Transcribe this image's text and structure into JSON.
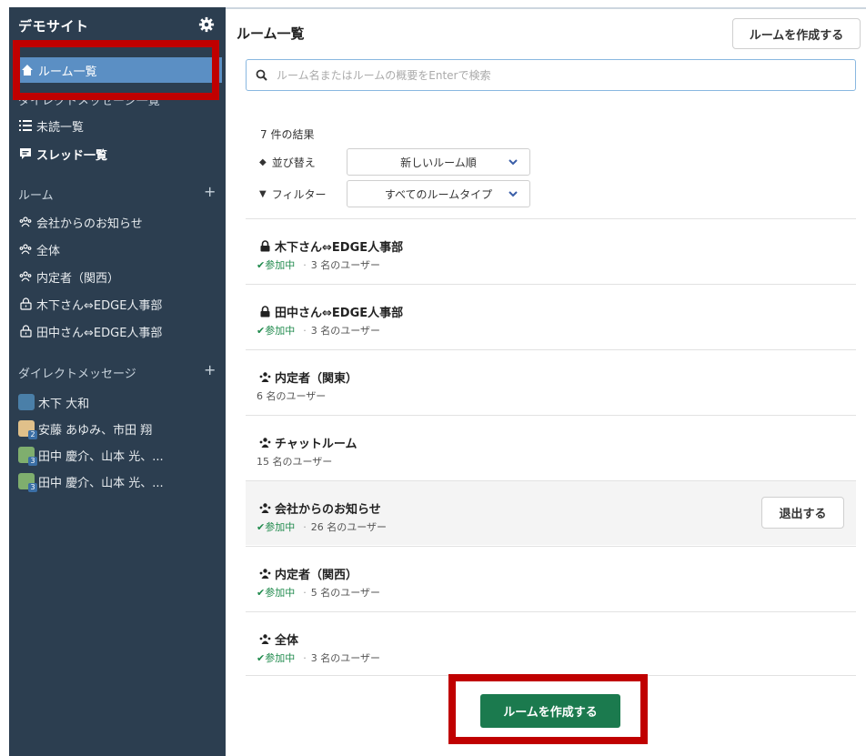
{
  "sidebar": {
    "title": "デモサイト",
    "nav": {
      "rooms_list": "ルーム一覧",
      "direct_list_hidden": "ダイレクトメッセージ一覧",
      "unread": "未読一覧",
      "threads": "スレッド一覧"
    },
    "rooms_section": "ルーム",
    "rooms": [
      {
        "label": "会社からのお知らせ",
        "icon": "group-icon"
      },
      {
        "label": "全体",
        "icon": "group-icon"
      },
      {
        "label": "内定者（関西）",
        "icon": "group-icon"
      },
      {
        "label": "木下さん⇔EDGE人事部",
        "icon": "lock-icon"
      },
      {
        "label": "田中さん⇔EDGE人事部",
        "icon": "lock-icon"
      }
    ],
    "dm_section": "ダイレクトメッセージ",
    "dms": [
      {
        "label": "木下 大和",
        "count": ""
      },
      {
        "label": "安藤 あゆみ、市田 翔",
        "count": "2"
      },
      {
        "label": "田中 慶介、山本 光、...",
        "count": "3"
      },
      {
        "label": "田中 慶介、山本 光、...",
        "count": "3"
      }
    ]
  },
  "main": {
    "title": "ルーム一覧",
    "create_button": "ルームを作成する",
    "search_placeholder": "ルーム名またはルームの概要をEnterで検索",
    "results": "7 件の結果",
    "sort_label": "並び替え",
    "sort_value": "新しいルーム順",
    "filter_label": "フィルター",
    "filter_value": "すべてのルームタイプ",
    "rooms": [
      {
        "name": "木下さん⇔EDGE人事部",
        "icon": "lock-icon",
        "joined": "✔参加中",
        "users": "3 名のユーザー"
      },
      {
        "name": "田中さん⇔EDGE人事部",
        "icon": "lock-icon",
        "joined": "✔参加中",
        "users": "3 名のユーザー"
      },
      {
        "name": "内定者（関東）",
        "icon": "group-icon",
        "joined": "",
        "users": "6 名のユーザー"
      },
      {
        "name": "チャットルーム",
        "icon": "group-icon",
        "joined": "",
        "users": "15 名のユーザー"
      },
      {
        "name": "会社からのお知らせ",
        "icon": "group-icon",
        "joined": "✔参加中",
        "users": "26 名のユーザー",
        "action": "退出する"
      },
      {
        "name": "内定者（関西）",
        "icon": "group-icon",
        "joined": "✔参加中",
        "users": "5 名のユーザー"
      },
      {
        "name": "全体",
        "icon": "group-icon",
        "joined": "✔参加中",
        "users": "3 名のユーザー"
      }
    ],
    "create_bottom": "ルームを作成する"
  },
  "colors": {
    "sidebar_bg": "#2c3e50",
    "active_item": "#5b8fc4",
    "joined": "#1f8a4c",
    "primary_button": "#1b7a4e",
    "highlight": "#c00000"
  }
}
